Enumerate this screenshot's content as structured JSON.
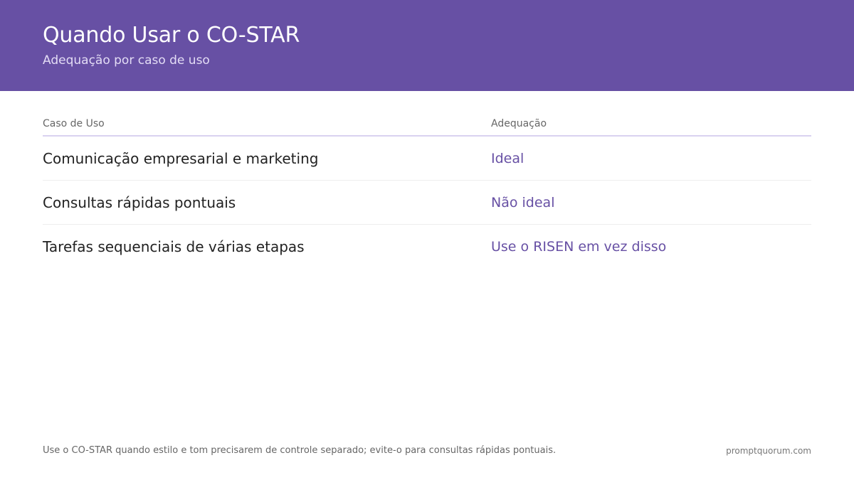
{
  "header": {
    "title": "Quando Usar o CO-STAR",
    "subtitle": "Adequação por caso de uso"
  },
  "table": {
    "columns": [
      "Caso de Uso",
      "Adequação"
    ],
    "rows": [
      {
        "case": "Comunicação empresarial e marketing",
        "fit": "Ideal"
      },
      {
        "case": "Consultas rápidas pontuais",
        "fit": "Não ideal"
      },
      {
        "case": "Tarefas sequenciais de várias etapas",
        "fit": "Use o RISEN em vez disso"
      }
    ]
  },
  "footer": {
    "note": "Use o CO-STAR quando estilo e tom precisarem de controle separado; evite-o para consultas rápidas pontuais.",
    "brand": "promptquorum.com"
  },
  "colors": {
    "header_bg": "#6750a4",
    "accent": "#6750a4"
  }
}
